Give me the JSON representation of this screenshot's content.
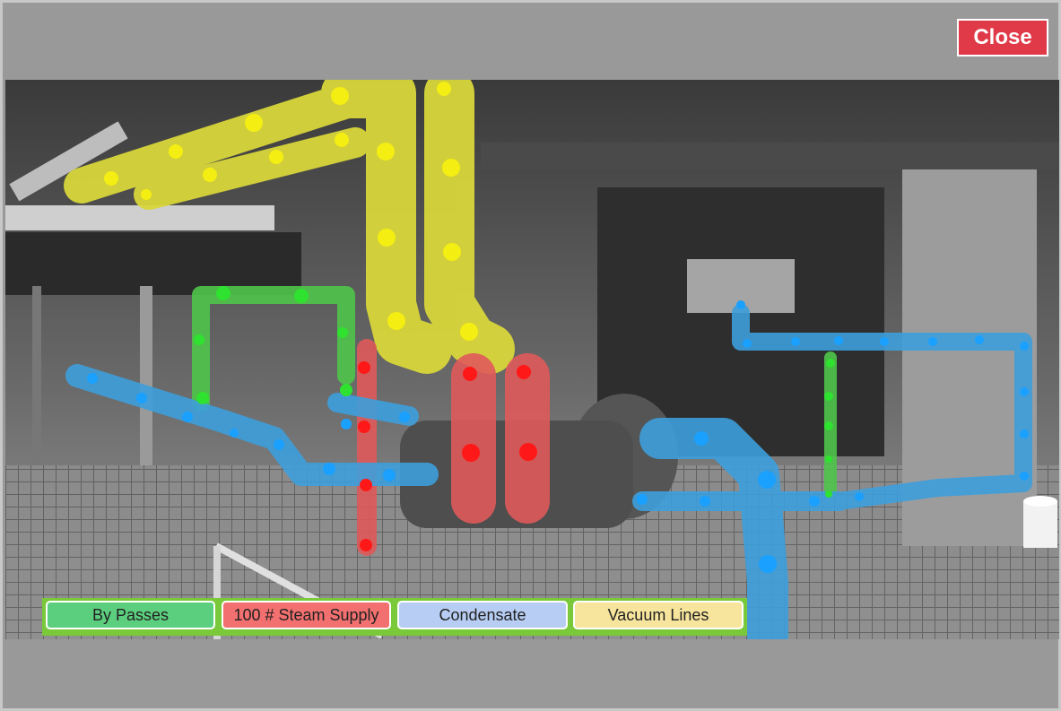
{
  "dialog": {
    "close_label": "Close",
    "colors": {
      "frame_bg": "#999999",
      "close_bg": "#e03a48",
      "legend_bar": "#79c93a"
    }
  },
  "photo": {
    "description_icon": "pipe-photo",
    "overlay_colors": {
      "vacuum": "#d8d63a",
      "steam": "#e05a5a",
      "condensate": "#3d9fdc",
      "bypass": "#4fc44a"
    }
  },
  "legend": {
    "items": [
      {
        "label": "By Passes",
        "color": "#5ccf7f"
      },
      {
        "label": "100 # Steam Supply",
        "color": "#f2706f"
      },
      {
        "label": "Condensate",
        "color": "#b7cdf3"
      },
      {
        "label": "Vacuum Lines",
        "color": "#f7e59d"
      }
    ]
  }
}
